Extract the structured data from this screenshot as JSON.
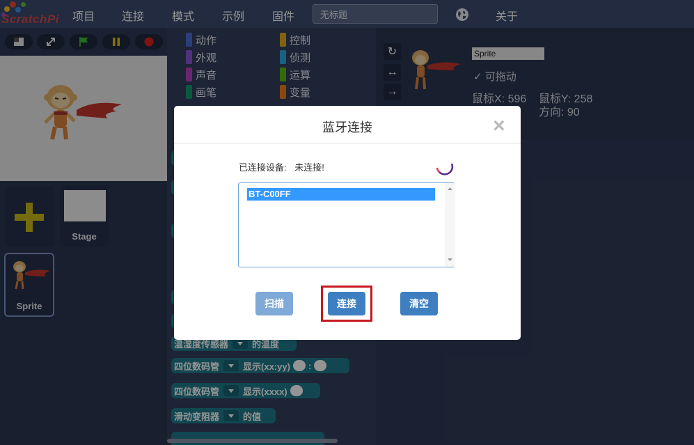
{
  "menubar": {
    "logo_text": "ScratchPi",
    "items": [
      "项目",
      "连接",
      "模式",
      "示例",
      "固件"
    ],
    "title_value": "无标题",
    "about": "关于"
  },
  "stage_toolbar": {
    "icons": [
      "small-stage-icon",
      "fullscreen-icon",
      "green-flag-icon",
      "pause-icon",
      "stop-icon"
    ]
  },
  "sprites": {
    "add_icon": "plus-icon",
    "stage_label": "Stage",
    "sprite_label": "Sprite"
  },
  "palette": {
    "categories_left": [
      {
        "label": "动作",
        "color": "#4a6cd4"
      },
      {
        "label": "外观",
        "color": "#8a55d7"
      },
      {
        "label": "声音",
        "color": "#bb42c3"
      },
      {
        "label": "画笔",
        "color": "#0e9a6c"
      }
    ],
    "categories_right": [
      {
        "label": "控制",
        "color": "#e1a91a"
      },
      {
        "label": "侦测",
        "color": "#2ca5e2"
      },
      {
        "label": "运算",
        "color": "#5cb712"
      },
      {
        "label": "变量",
        "color": "#ee7d16"
      }
    ],
    "blocks": [
      {
        "a": "温湿度传感器",
        "b": "的温度"
      },
      {
        "a": "四位数码管",
        "b": "显示(xx:yy)",
        "c": ":"
      },
      {
        "a": "四位数码管",
        "b": "显示(xxxx)"
      },
      {
        "a": "滑动变阻器",
        "b": "的值"
      }
    ]
  },
  "sprite_info": {
    "name": "Sprite",
    "draggable": "可拖动",
    "mouse_x": "鼠标X: 596",
    "mouse_y": "鼠标Y: 258",
    "direction": "方向: 90",
    "rotate_icons": [
      "rotate-icon",
      "left-right-icon",
      "no-rotate-icon"
    ]
  },
  "modal": {
    "title": "蓝牙连接",
    "close": "×",
    "connected_label": "已连接设备:",
    "connected_value": "未连接!",
    "devices": [
      "BT-C00FF"
    ],
    "buttons": {
      "scan": "扫描",
      "connect": "连接",
      "clear": "清空"
    },
    "colors": {
      "scan": "#7fa9d6",
      "connect": "#3d7fc1",
      "clear": "#3d7fc1",
      "highlight": "#c8181e"
    }
  }
}
